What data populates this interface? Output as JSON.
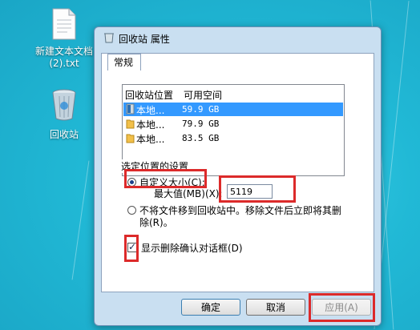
{
  "desktop": {
    "icons": [
      {
        "label": "新建文本文档\n(2).txt",
        "icon": "text-file-icon"
      },
      {
        "label": "回收站",
        "icon": "recycle-bin-icon"
      }
    ]
  },
  "window": {
    "title": "回收站 属性",
    "tab": "常规",
    "list": {
      "headers": [
        "回收站位置",
        "可用空间"
      ],
      "rows": [
        {
          "name": "本地...",
          "space": "59.9 GB",
          "selected": true
        },
        {
          "name": "本地...",
          "space": "79.9 GB",
          "selected": false
        },
        {
          "name": "本地...",
          "space": "83.5 GB",
          "selected": false
        }
      ]
    },
    "settings_group": "选定位置的设置",
    "custom_size_label": "自定义大小(C):",
    "max_size_label": "最大值(MB)(X):",
    "max_size_value": "5119",
    "no_recycle_label_1": "不将文件移到回收站中。移除文件后立即将其删",
    "no_recycle_label_2": "除(R)。",
    "confirm_delete_label": "显示删除确认对话框(D)",
    "buttons": {
      "ok": "确定",
      "cancel": "取消",
      "apply": "应用(A)"
    }
  },
  "colors": {
    "highlight": "#dc2a2a",
    "selection": "#3399ff",
    "desktop": "#21b9d6"
  }
}
